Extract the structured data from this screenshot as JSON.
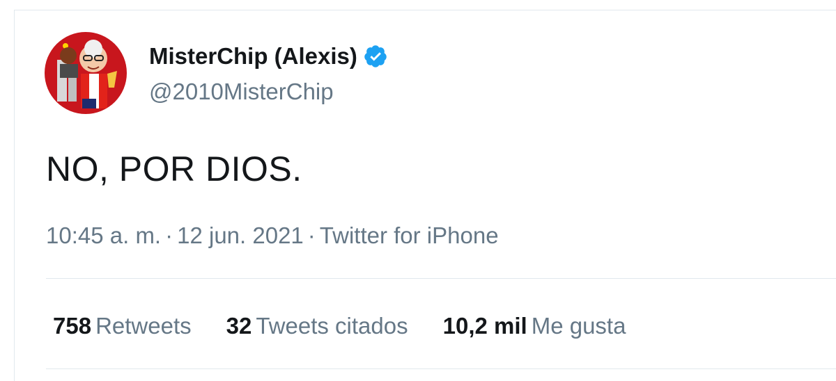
{
  "tweet": {
    "display_name": "MisterChip (Alexis)",
    "handle": "@2010MisterChip",
    "verified_icon": "verified-badge-icon",
    "text": "NO, POR DIOS.",
    "time": "10:45 a. m.",
    "date": "12 jun. 2021",
    "source": "Twitter for iPhone",
    "separator": "·"
  },
  "stats": {
    "retweets_count": "758",
    "retweets_label": "Retweets",
    "quotes_count": "32",
    "quotes_label": "Tweets citados",
    "likes_count": "10,2 mil",
    "likes_label": "Me gusta"
  },
  "colors": {
    "text_primary": "#14171a",
    "text_secondary": "#657786",
    "verified_blue": "#1da1f2",
    "divider": "#e1e8ed",
    "avatar_background": "#c8161d"
  }
}
